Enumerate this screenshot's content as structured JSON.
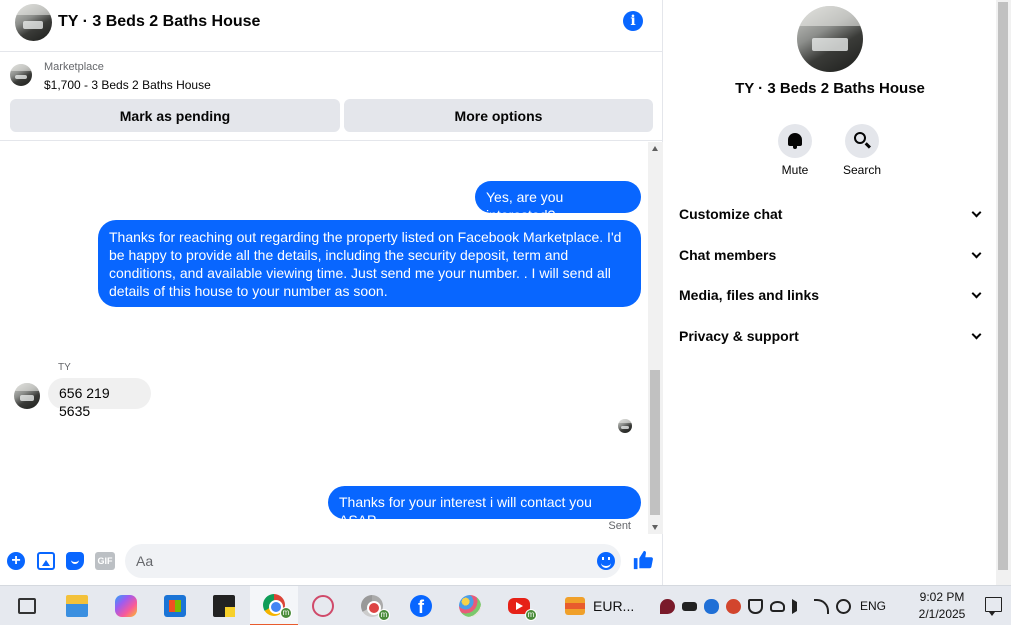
{
  "chat": {
    "title": "TY · 3 Beds 2 Baths House",
    "info_icon": "info-icon"
  },
  "marketplace": {
    "label": "Marketplace",
    "item": "$1,700 - 3 Beds 2 Baths House",
    "pending_button": "Mark as pending",
    "more_button": "More options"
  },
  "messages": [
    {
      "direction": "out",
      "text": "Yes, are you interested?"
    },
    {
      "direction": "out",
      "text": "Thanks for reaching out regarding the property listed on Facebook Marketplace. I'd be happy to provide all the details, including the security deposit, term and conditions, and available viewing time. Just send me your number. . I will send all details of this house to your number as soon."
    },
    {
      "direction": "in",
      "sender": "TY",
      "text": "656 219 5635"
    },
    {
      "direction": "out",
      "text": "Thanks for your interest i will contact you ASAP."
    }
  ],
  "status": {
    "sent": "Sent"
  },
  "composer": {
    "placeholder": "Aa",
    "icons": [
      "plus-icon",
      "image-icon",
      "sticker-icon",
      "gif-icon",
      "emoji-icon",
      "like-icon"
    ],
    "gif_label": "GIF"
  },
  "info": {
    "title": "TY · 3 Beds 2 Baths House",
    "mute_label": "Mute",
    "search_label": "Search",
    "sections": [
      "Customize chat",
      "Chat members",
      "Media, files and links",
      "Privacy & support"
    ]
  },
  "taskbar": {
    "apps": [
      "task-view-icon",
      "file-explorer-icon",
      "copilot-icon",
      "microsoft-store-icon",
      "sticky-notes-icon",
      "chrome-icon",
      "snipping-tool-icon",
      "chrome-profile-icon",
      "facebook-icon",
      "paint-icon",
      "youtube-icon"
    ],
    "ticker": "EUR...",
    "language": "ENG",
    "time": "9:02 PM",
    "date": "2/1/2025"
  },
  "colors": {
    "accent": "#0866ff",
    "incoming_bubble": "#f0f0f0",
    "button_bg": "#e4e6eb"
  }
}
